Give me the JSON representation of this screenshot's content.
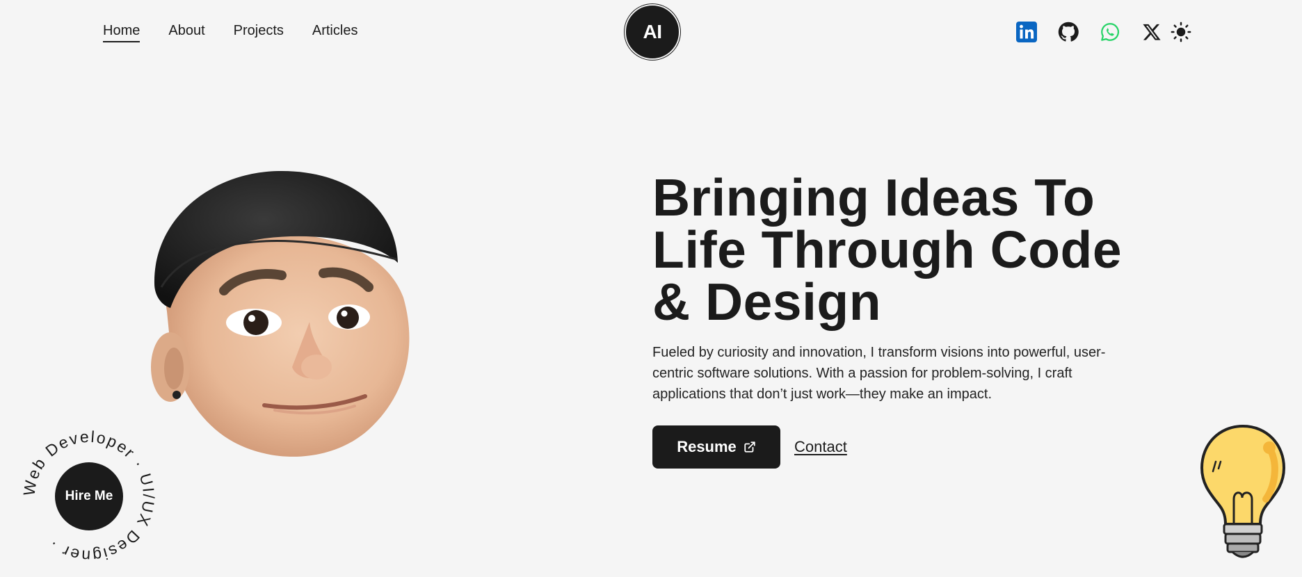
{
  "nav": {
    "items": [
      {
        "label": "Home",
        "active": true
      },
      {
        "label": "About",
        "active": false
      },
      {
        "label": "Projects",
        "active": false
      },
      {
        "label": "Articles",
        "active": false
      }
    ]
  },
  "logo": {
    "text": "AI"
  },
  "social": {
    "icons": [
      "linkedin-icon",
      "github-icon",
      "whatsapp-icon",
      "x-twitter-icon",
      "sun-theme-icon"
    ],
    "colors": {
      "linkedin": "#0a66c2",
      "whatsapp": "#25d366",
      "dark": "#1b1b1b"
    }
  },
  "hero": {
    "headline_lines": [
      "Bringing Ideas To",
      "Life Through Code",
      "& Design"
    ],
    "lead_lines": [
      "Fueled by curiosity and innovation, I transform visions into powerful, user-",
      "centric software solutions. With a passion for problem-solving, I craft",
      "applications that don’t just work—they make an impact."
    ],
    "resume_label": "Resume",
    "contact_label": "Contact"
  },
  "badge": {
    "button_label": "Hire Me",
    "ring_text": "Web Developer · UI/UX Designer ·"
  },
  "colors": {
    "background": "#f5f5f5",
    "text": "#1b1b1b",
    "bulb": "#fcd86a"
  }
}
